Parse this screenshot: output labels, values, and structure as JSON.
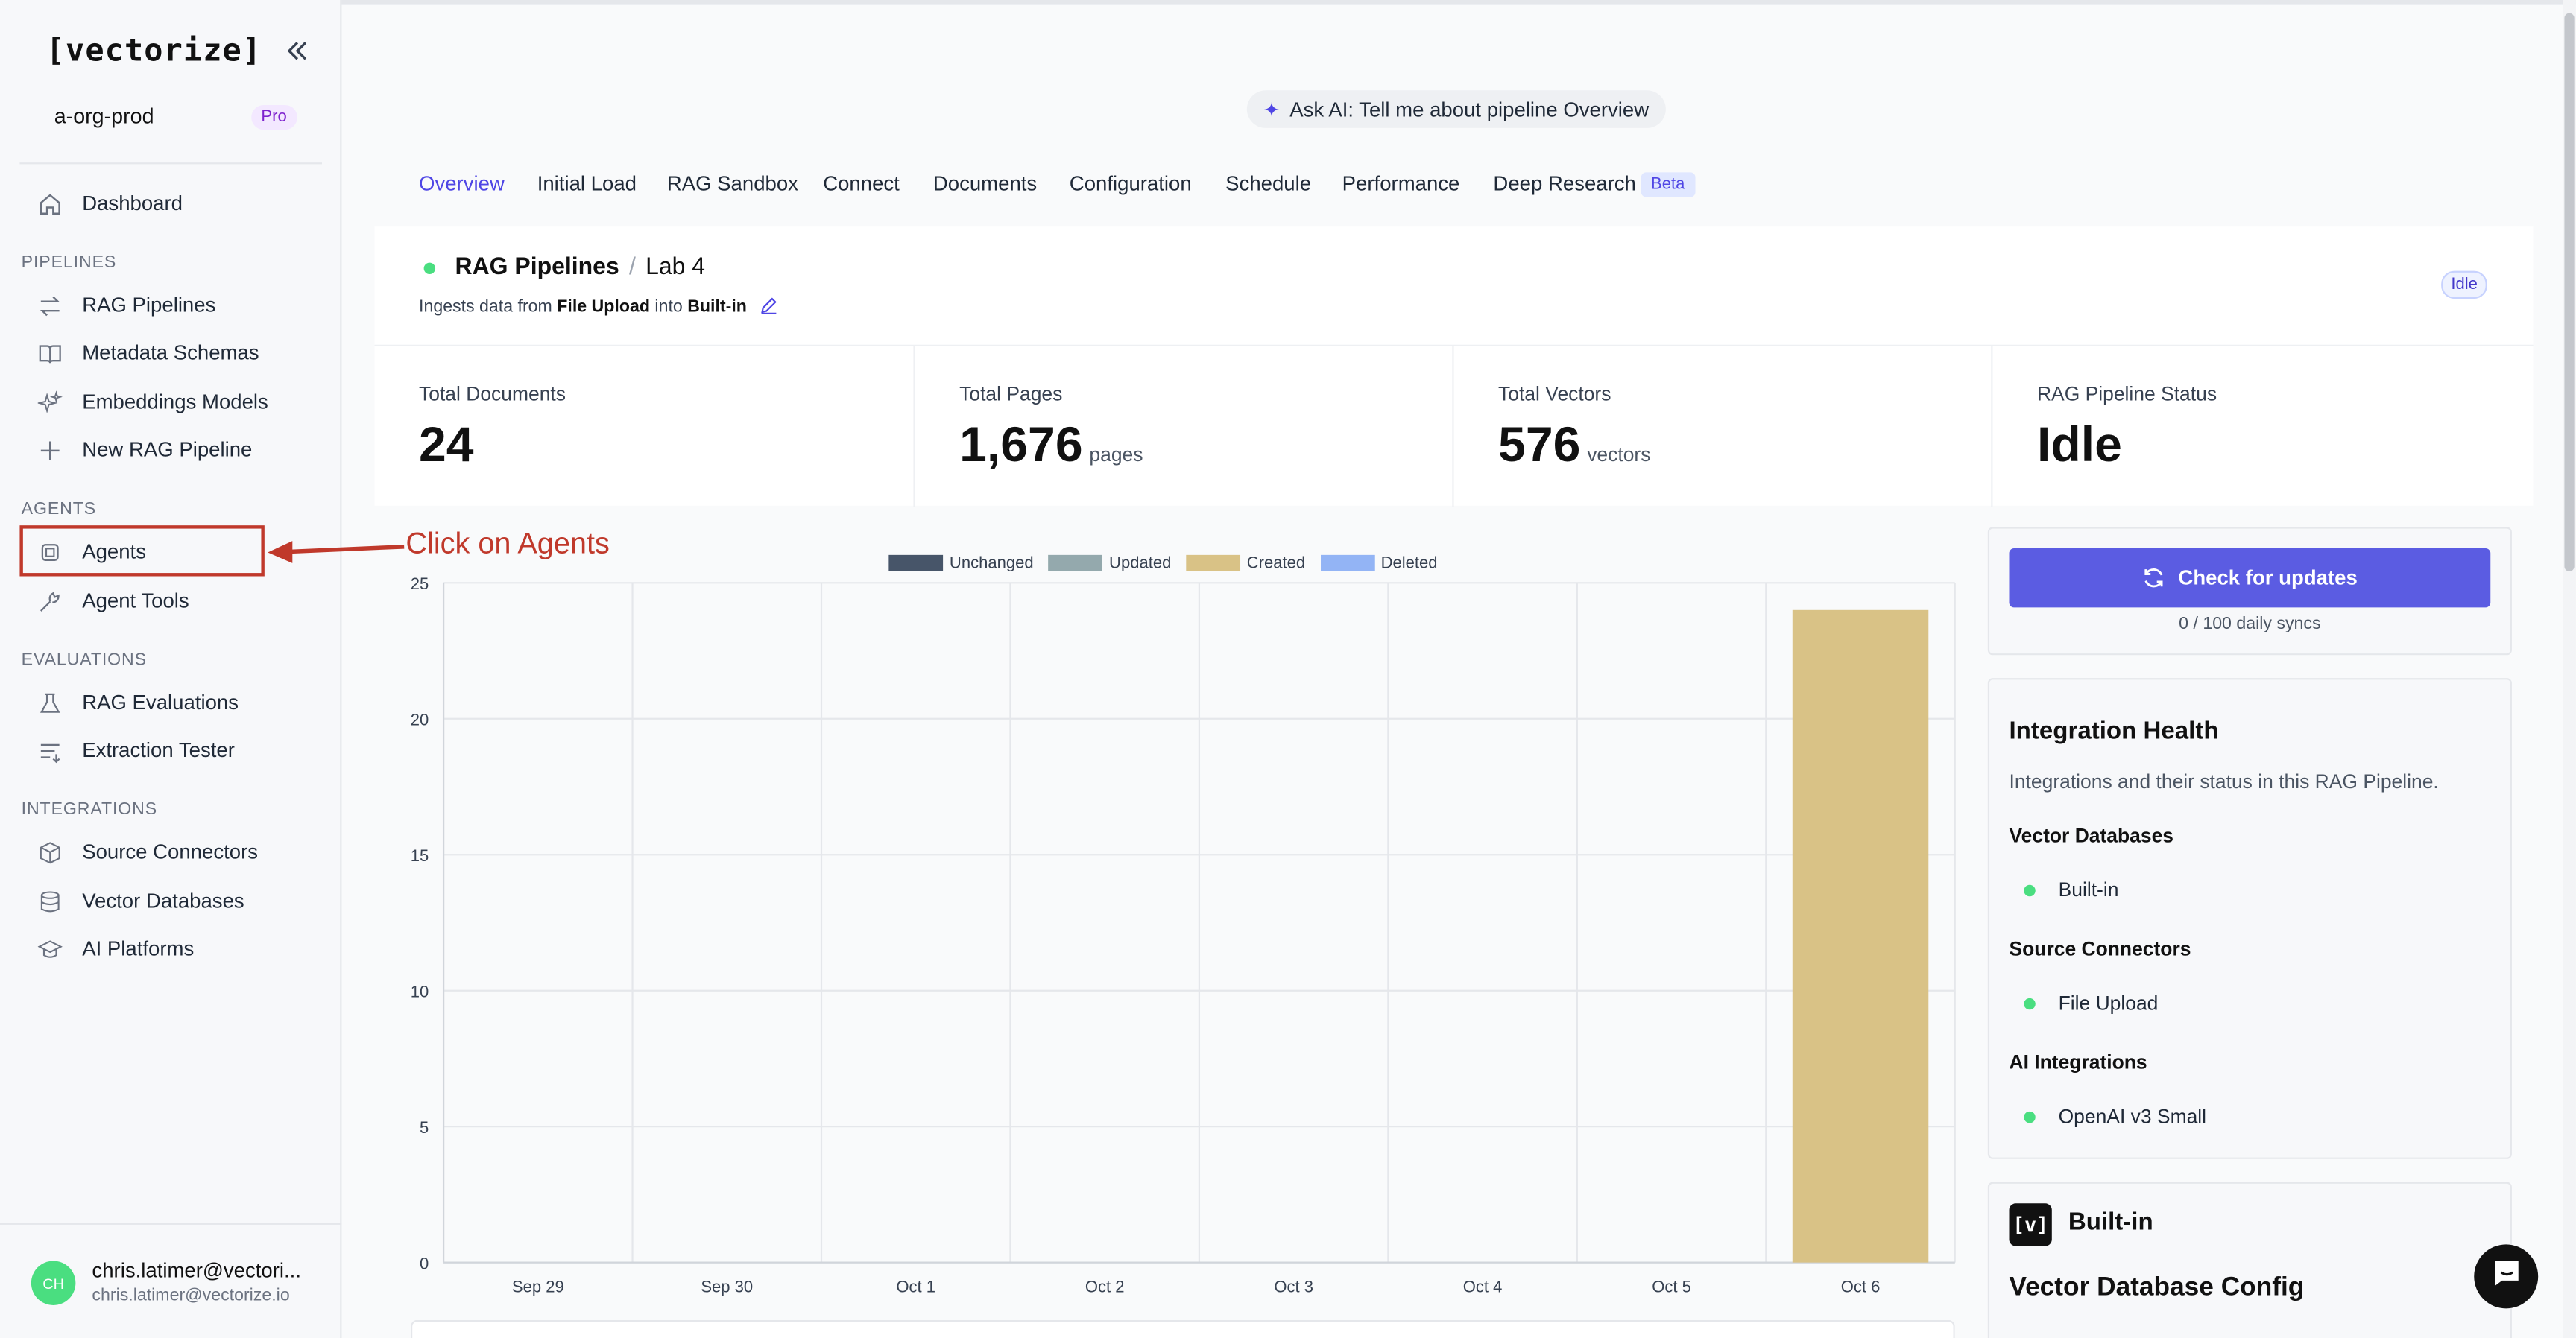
{
  "sidebar": {
    "logo": "[vectorize]",
    "org": "a-org-prod",
    "plan_badge": "Pro",
    "dashboard": "Dashboard",
    "sections": {
      "pipelines": "PIPELINES",
      "agents": "AGENTS",
      "evaluations": "EVALUATIONS",
      "integrations": "INTEGRATIONS"
    },
    "items": {
      "rag_pipelines": "RAG Pipelines",
      "metadata_schemas": "Metadata Schemas",
      "embeddings_models": "Embeddings Models",
      "new_rag_pipeline": "New RAG Pipeline",
      "agents": "Agents",
      "agent_tools": "Agent Tools",
      "rag_evaluations": "RAG Evaluations",
      "extraction_tester": "Extraction Tester",
      "source_connectors": "Source Connectors",
      "vector_databases": "Vector Databases",
      "ai_platforms": "AI Platforms"
    },
    "user": {
      "initials": "CH",
      "name": "chris.latimer@vectori...",
      "email": "chris.latimer@vectorize.io"
    }
  },
  "annotation": {
    "text": "Click on Agents",
    "color": "#c0392b"
  },
  "ask_ai": "Ask AI: Tell me about pipeline Overview",
  "tabs": [
    "Overview",
    "Initial Load",
    "RAG Sandbox",
    "Connect",
    "Documents",
    "Configuration",
    "Schedule",
    "Performance",
    "Deep Research"
  ],
  "active_tab": "Overview",
  "beta_badge": "Beta",
  "header": {
    "crumb_root": "RAG Pipelines",
    "crumb_sep": "/",
    "crumb_current": "Lab 4",
    "ingests_prefix": "Ingests data from",
    "source": "File Upload",
    "ingests_mid": "into",
    "destination": "Built-in",
    "status_badge": "Idle"
  },
  "stats": [
    {
      "label": "Total Documents",
      "value": "24",
      "unit": ""
    },
    {
      "label": "Total Pages",
      "value": "1,676",
      "unit": "pages"
    },
    {
      "label": "Total Vectors",
      "value": "576",
      "unit": "vectors"
    },
    {
      "label": "RAG Pipeline Status",
      "value": "Idle",
      "unit": ""
    }
  ],
  "chart_data": {
    "type": "bar",
    "stacked": true,
    "categories": [
      "Sep 29",
      "Sep 30",
      "Oct 1",
      "Oct 2",
      "Oct 3",
      "Oct 4",
      "Oct 5",
      "Oct 6"
    ],
    "series": [
      {
        "name": "Unchanged",
        "color": "#475569",
        "values": [
          0,
          0,
          0,
          0,
          0,
          0,
          0,
          0
        ]
      },
      {
        "name": "Updated",
        "color": "#94a9ad",
        "values": [
          0,
          0,
          0,
          0,
          0,
          0,
          0,
          0
        ]
      },
      {
        "name": "Created",
        "color": "#d9c286",
        "values": [
          0,
          0,
          0,
          0,
          0,
          0,
          0,
          24
        ]
      },
      {
        "name": "Deleted",
        "color": "#93b4f5",
        "values": [
          0,
          0,
          0,
          0,
          0,
          0,
          0,
          0
        ]
      }
    ],
    "ylim": [
      0,
      25
    ],
    "yticks": [
      0,
      5,
      10,
      15,
      20,
      25
    ],
    "grid": true,
    "legend": "top-center"
  },
  "sync": {
    "button_label": "Check for updates",
    "daily_syncs": "0 / 100 daily syncs"
  },
  "integration_health": {
    "title": "Integration Health",
    "subtitle": "Integrations and their status in this RAG Pipeline.",
    "groups": [
      {
        "heading": "Vector Databases",
        "item": "Built-in"
      },
      {
        "heading": "Source Connectors",
        "item": "File Upload"
      },
      {
        "heading": "AI Integrations",
        "item": "OpenAI v3 Small"
      }
    ]
  },
  "builtin": {
    "logo": "[v]",
    "title": "Built-in",
    "config_title": "Vector Database Config"
  },
  "colors": {
    "accent": "#4f46e5",
    "button": "#5b5ce2",
    "status_green": "#4ade80"
  }
}
